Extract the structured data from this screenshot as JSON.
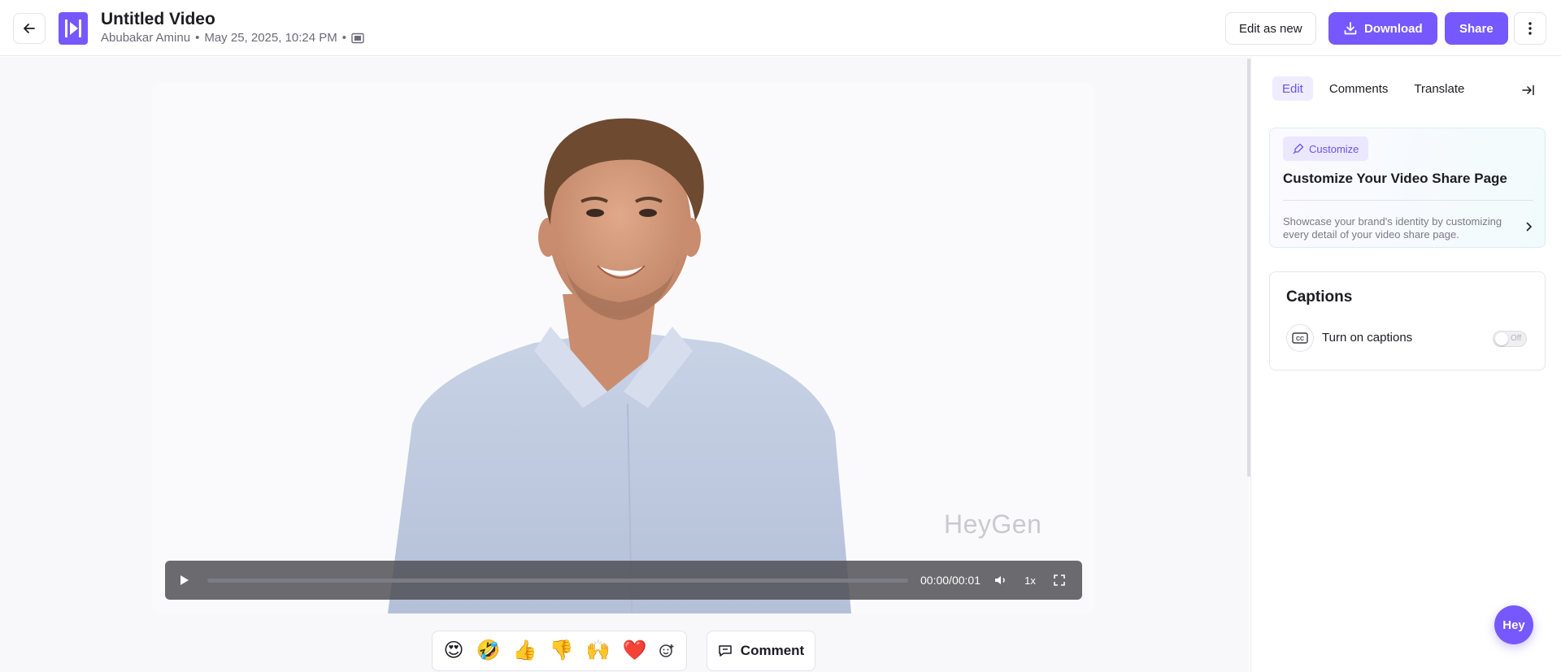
{
  "header": {
    "title": "Untitled Video",
    "author": "Abubakar Aminu",
    "date": "May 25, 2025, 10:24 PM",
    "separator": "•",
    "edit_as_new_label": "Edit as new",
    "download_label": "Download",
    "share_label": "Share"
  },
  "player": {
    "time": "00:00/00:01",
    "speed": "1x",
    "watermark": "HeyGen",
    "progress": 0
  },
  "reactions": {
    "emojis": [
      "😍",
      "🤣",
      "👍",
      "👎",
      "🙌",
      "❤️"
    ]
  },
  "comment_label": "Comment",
  "panel": {
    "tabs": [
      "Edit",
      "Comments",
      "Translate"
    ],
    "active_tab": "Edit",
    "customize": {
      "badge": "Customize",
      "title": "Customize Your Video Share Page",
      "description": "Showcase your brand's identity by customizing every detail of your video share page."
    },
    "captions": {
      "title": "Captions",
      "label": "Turn on captions",
      "toggle_state": "Off"
    }
  },
  "fab_label": "Hey",
  "colors": {
    "accent": "#7559ff",
    "accent_soft": "#efecff"
  }
}
